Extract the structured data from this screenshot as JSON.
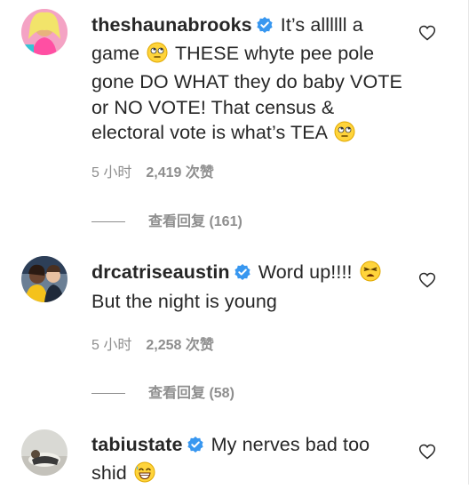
{
  "comments": [
    {
      "username": "theshaunabrooks",
      "text_parts": [
        "It’s allllll a game ",
        " THESE whyte pee pole gone DO WHAT they do baby VOTE or NO VOTE! That census & electoral vote is what’s TEA "
      ],
      "emojis": [
        "rolling-eyes-emoji",
        "rolling-eyes-emoji"
      ],
      "time": "5 小时",
      "likes": "2,419 次赞",
      "replies": "查看回复 (161)"
    },
    {
      "username": "drcatriseaustin",
      "text_parts": [
        "Word up!!!! ",
        "But the night is young"
      ],
      "emojis": [
        "weary-face-emoji"
      ],
      "time": "5 小时",
      "likes": "2,258 次赞",
      "replies": "查看回复 (58)"
    },
    {
      "username": "tabiustate",
      "text_parts": [
        "My nerves bad too shid "
      ],
      "emojis": [
        "grinning-sweat-emoji"
      ]
    }
  ],
  "colors": {
    "text": "#262626",
    "muted": "#8e8e8e",
    "verified": "#3897f0"
  },
  "icons": [
    "verified-badge-icon",
    "heart-icon"
  ]
}
